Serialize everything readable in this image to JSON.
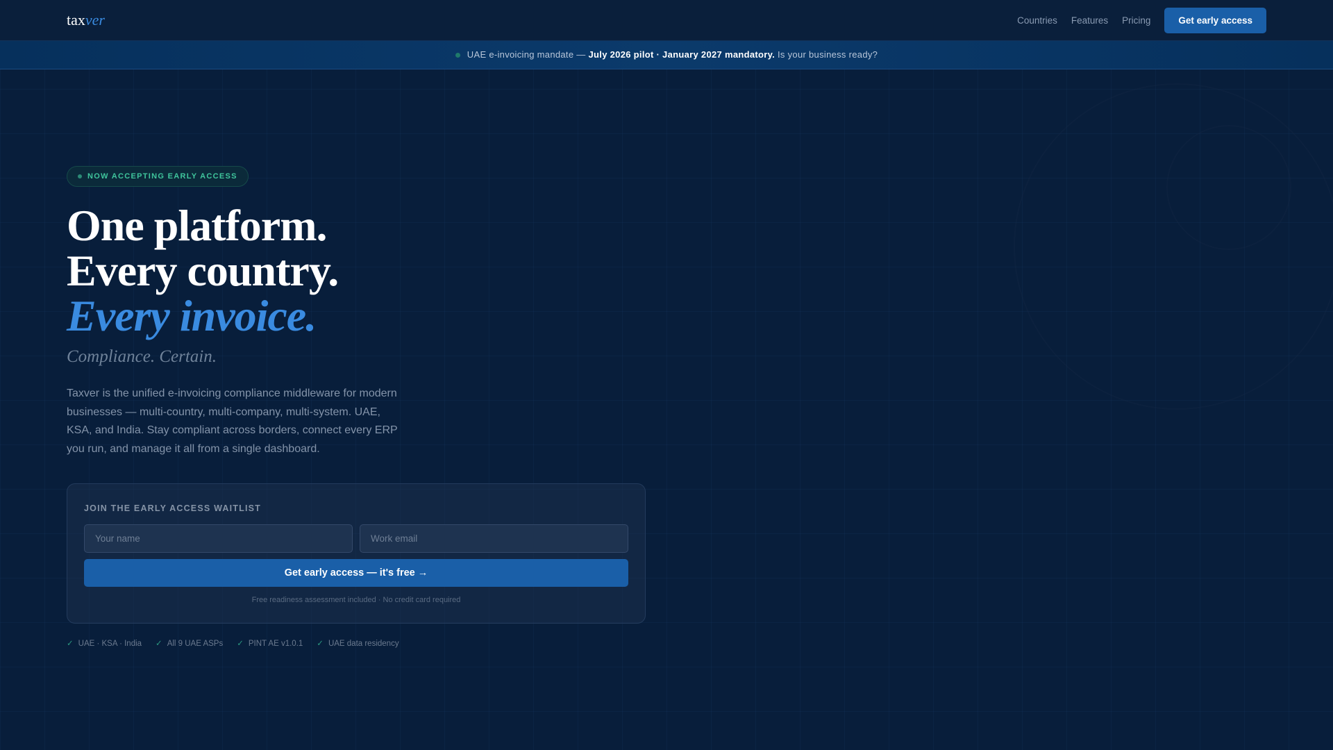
{
  "nav": {
    "logo_a": "tax",
    "logo_b": "ver",
    "links": [
      "Countries",
      "Features",
      "Pricing"
    ],
    "cta": "Get early access"
  },
  "banner": {
    "lead": "UAE e-invoicing mandate —",
    "bold": "July 2026 pilot · January 2027 mandatory.",
    "tail": "Is your business ready?"
  },
  "hero": {
    "badge": "NOW ACCEPTING EARLY ACCESS",
    "line1": "One platform.",
    "line2": "Every country.",
    "line3": "Every invoice.",
    "tagline": "Compliance. Certain.",
    "description": "Taxver is the unified e-invoicing compliance middleware for modern businesses — multi-country, multi-company, multi-system. UAE, KSA, and India. Stay compliant across borders, connect every ERP you run, and manage it all from a single dashboard."
  },
  "form": {
    "title": "JOIN THE EARLY ACCESS WAITLIST",
    "name_placeholder": "Your name",
    "email_placeholder": "Work email",
    "submit": "Get early access — it's free →",
    "note": "Free readiness assessment included · No credit card required"
  },
  "checks": [
    "UAE · KSA · India",
    "All 9 UAE ASPs",
    "PINT AE v1.0.1",
    "UAE data residency"
  ],
  "colors": {
    "accent": "#3a8be0",
    "button": "#1a5fa8",
    "success": "#3fc59c"
  }
}
